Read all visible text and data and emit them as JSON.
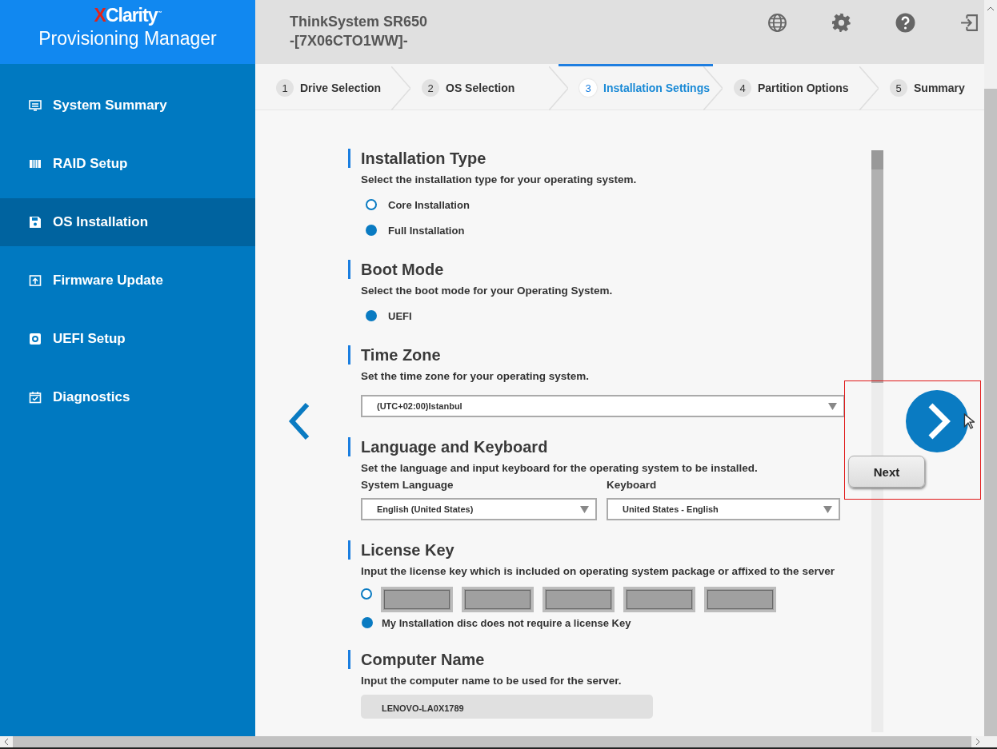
{
  "logo": {
    "mark": "X",
    "brand": "Clarity",
    "trademark": "™",
    "product": "Provisioning Manager"
  },
  "header": {
    "title": "ThinkSystem SR650",
    "model": "-[7X06CTO1WW]-"
  },
  "sidebar": {
    "items": [
      {
        "label": "System Summary",
        "selected": false
      },
      {
        "label": "RAID Setup",
        "selected": false
      },
      {
        "label": "OS Installation",
        "selected": true
      },
      {
        "label": "Firmware Update",
        "selected": false
      },
      {
        "label": "UEFI Setup",
        "selected": false
      },
      {
        "label": "Diagnostics",
        "selected": false
      }
    ]
  },
  "steps": [
    {
      "number": "1",
      "label": "Drive Selection",
      "selected": false
    },
    {
      "number": "2",
      "label": "OS Selection",
      "selected": false
    },
    {
      "number": "3",
      "label": "Installation Settings",
      "selected": true
    },
    {
      "number": "4",
      "label": "Partition Options",
      "selected": false
    },
    {
      "number": "5",
      "label": "Summary",
      "selected": false
    }
  ],
  "sections": [
    {
      "title": "Installation Type",
      "description": "Select the installation type for your operating system.",
      "controls": [
        {
          "kind": "radio",
          "label": "Core Installation",
          "selected": false
        },
        {
          "kind": "radio",
          "label": "Full Installation",
          "selected": true
        }
      ]
    },
    {
      "title": "Boot Mode",
      "description": "Select the boot mode for your Operating System.",
      "controls": [
        {
          "kind": "radio",
          "label": "UEFI",
          "selected": true
        }
      ]
    },
    {
      "title": "Time Zone",
      "description": "Set the time zone for your operating system.",
      "controls": [
        {
          "kind": "select",
          "value": "(UTC+02:00)Istanbul"
        }
      ]
    },
    {
      "title": "Language and Keyboard",
      "description": "Set the language and input keyboard for the operating system to be installed.",
      "controls": [
        {
          "kind": "select_pair",
          "fields": [
            {
              "label": "System Language",
              "value": "English (United States)"
            },
            {
              "label": "Keyboard",
              "value": "United States - English"
            }
          ]
        }
      ]
    },
    {
      "title": "License Key",
      "description": "Input the license key which is included on operating system package or affixed to the server",
      "controls": [
        {
          "kind": "key_entry",
          "selected": false
        },
        {
          "kind": "radio",
          "label": "My Installation disc does not require a license Key",
          "selected": true
        }
      ]
    },
    {
      "title": "Computer Name",
      "description": "Input the computer name to be used for the server.",
      "controls": [
        {
          "kind": "text",
          "value": "LENOVO-LA0X1789"
        }
      ]
    }
  ],
  "next_button": {
    "label": "Next"
  }
}
